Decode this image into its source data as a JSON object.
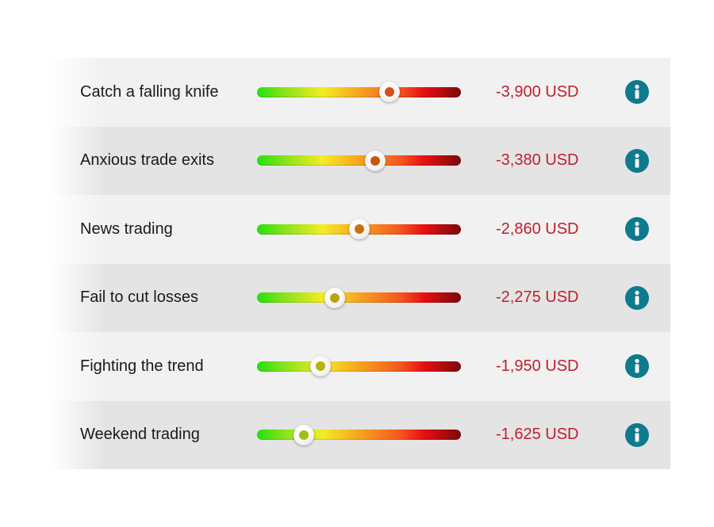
{
  "colors": {
    "amount": "#c0202c",
    "info_icon": "#0e7a8e"
  },
  "rows": [
    {
      "label": "Catch a falling knife",
      "level": 0.65,
      "knob_color": "#d2501a",
      "amount": "-3,900 USD",
      "icon": "info-icon"
    },
    {
      "label": "Anxious trade exits",
      "level": 0.58,
      "knob_color": "#c8570f",
      "amount": "-3,380 USD",
      "icon": "info-icon"
    },
    {
      "label": "News trading",
      "level": 0.5,
      "knob_color": "#c8700f",
      "amount": "-2,860 USD",
      "icon": "info-icon"
    },
    {
      "label": "Fail to cut losses",
      "level": 0.38,
      "knob_color": "#b9a40e",
      "amount": "-2,275 USD",
      "icon": "info-icon"
    },
    {
      "label": "Fighting the trend",
      "level": 0.31,
      "knob_color": "#b7b30e",
      "amount": "-1,950 USD",
      "icon": "info-icon"
    },
    {
      "label": "Weekend trading",
      "level": 0.23,
      "knob_color": "#9fbf10",
      "amount": "-1,625 USD",
      "icon": "info-icon"
    }
  ]
}
